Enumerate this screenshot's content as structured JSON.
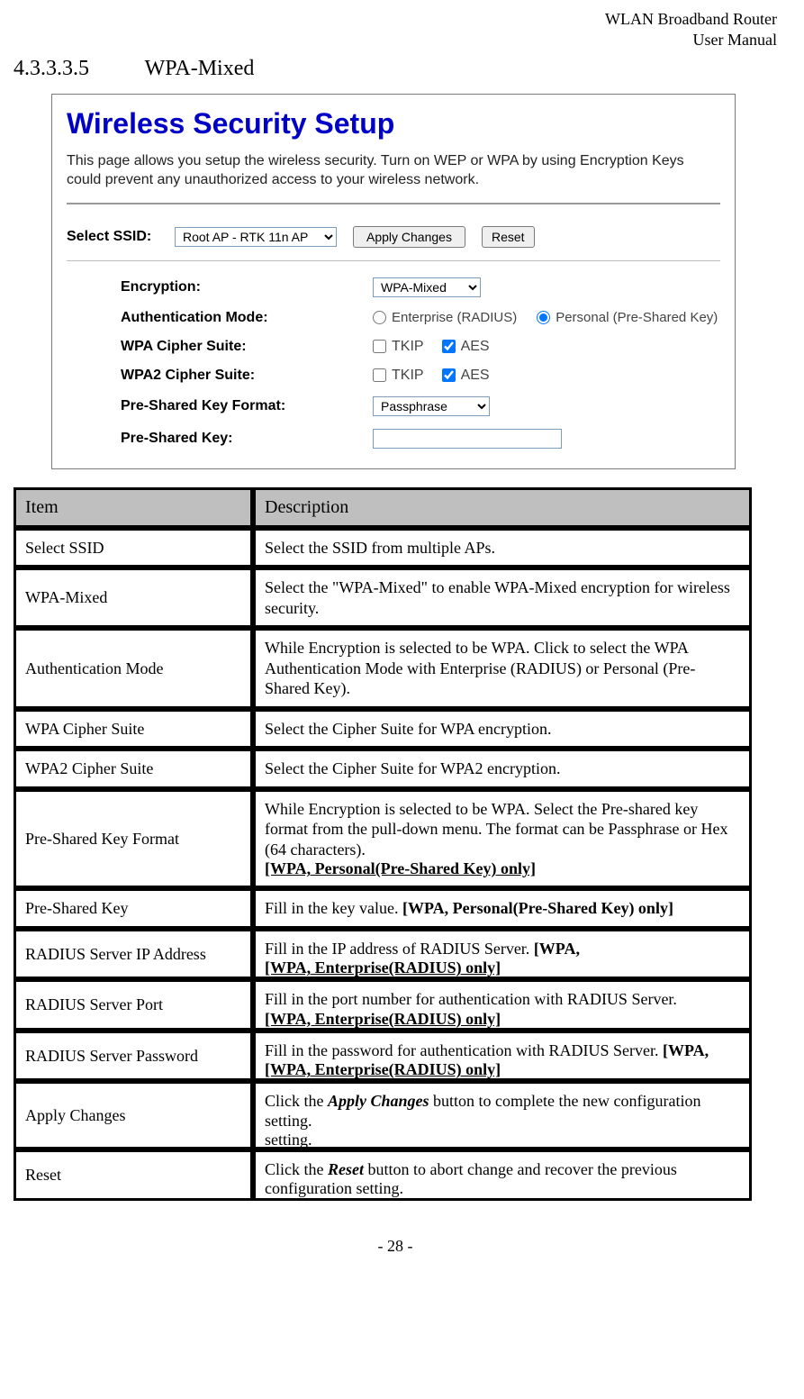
{
  "header": {
    "line1": "WLAN  Broadband  Router",
    "line2": "User  Manual"
  },
  "section": {
    "number": "4.3.3.3.5",
    "title": "WPA-Mixed"
  },
  "screenshot": {
    "title": "Wireless Security Setup",
    "description": "This page allows you setup the wireless security. Turn on WEP or WPA by using Encryption Keys could prevent any unauthorized access to your wireless network.",
    "labels": {
      "select_ssid": "Select SSID:",
      "encryption": "Encryption:",
      "auth_mode": "Authentication Mode:",
      "wpa_cipher": "WPA Cipher Suite:",
      "wpa2_cipher": "WPA2 Cipher Suite:",
      "psk_format": "Pre-Shared Key Format:",
      "psk": "Pre-Shared Key:"
    },
    "values": {
      "ssid": "Root AP - RTK 11n AP",
      "apply_btn": "Apply Changes",
      "reset_btn": "Reset",
      "encryption": "WPA-Mixed",
      "auth_radius": "Enterprise (RADIUS)",
      "auth_personal": "Personal (Pre-Shared Key)",
      "tkip": "TKIP",
      "aes": "AES",
      "psk_format": "Passphrase",
      "psk_value": ""
    }
  },
  "table": {
    "header_item": "Item",
    "header_desc": "Description",
    "rows": [
      {
        "item": "Select SSID",
        "desc": "Select the SSID from multiple APs."
      },
      {
        "item": "WPA-Mixed",
        "desc": "Select the \"WPA-Mixed\" to enable WPA-Mixed encryption for wireless security."
      },
      {
        "item": "Authentication Mode",
        "desc": "While Encryption is selected to be WPA. Click to select the WPA Authentication Mode with Enterprise (RADIUS) or Personal (Pre-Shared Key)."
      },
      {
        "item": "WPA Cipher Suite",
        "desc": "Select the Cipher Suite for WPA encryption."
      },
      {
        "item": "WPA2 Cipher Suite",
        "desc": "Select the Cipher Suite for WPA2 encryption."
      },
      {
        "item": "Pre-Shared Key Format",
        "desc": "While Encryption is selected to be WPA. Select the Pre-shared key format from the pull-down menu. The format can be Passphrase or Hex (64 characters).",
        "note": "[WPA, Personal(Pre-Shared Key) only]"
      },
      {
        "item": "Pre-Shared Key",
        "desc_prefix": "Fill in the key value. ",
        "note_inline": "[WPA, Personal(Pre-Shared Key) only]"
      },
      {
        "item": "RADIUS Server IP Address",
        "desc_prefix": "Fill in the IP address of RADIUS Server. ",
        "note_clip": "[WPA, Enterprise(RADIUS) only]"
      },
      {
        "item": "RADIUS Server Port",
        "desc": "Fill in the port number for authentication with RADIUS Server.",
        "note_clip": "[WPA, Enterprise(RADIUS) only]"
      },
      {
        "item": "RADIUS Server Password",
        "desc_prefix": "Fill in the password for authentication with RADIUS Server. ",
        "note_clip": "[WPA, Enterprise(RADIUS) only]"
      },
      {
        "item": "Apply Changes",
        "desc_prefix": "Click the ",
        "emph": "Apply Changes",
        "desc_tail_clip": " button to complete the new configuration setting."
      },
      {
        "item": "Reset",
        "desc_prefix": "Click the ",
        "emph": "Reset",
        "desc_tail_clip": " button to abort change and recover the previous configuration setting."
      }
    ]
  },
  "page_number": "- 28 -"
}
